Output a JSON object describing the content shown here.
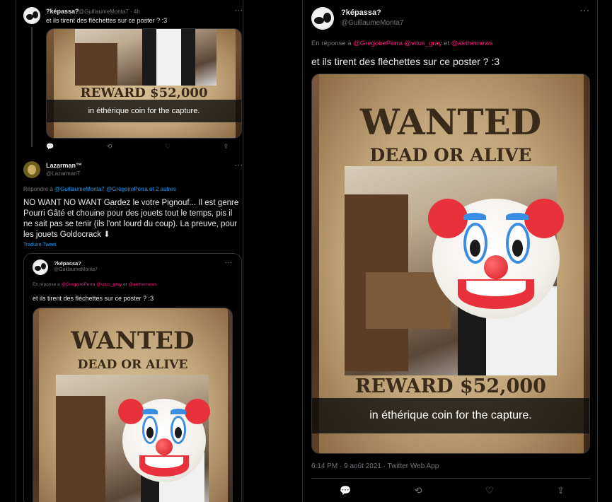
{
  "left": {
    "tweet1": {
      "name": "?képassa?",
      "handle": "@GuillaumeMonta7 · 4h",
      "more": "···",
      "text": "et ils tirent des fléchettes sur ce poster ? :3",
      "media": {
        "reward": "REWARD $52,000",
        "caption": "in éthérique coin for the capture."
      },
      "actions": {
        "reply": "💬",
        "retweet": "⟲",
        "like": "♡",
        "share": "⇪"
      }
    },
    "tweet2": {
      "name": "Lazarman™",
      "handle": "@LazarmanT",
      "more": "···",
      "reply_prefix": "Répondre à ",
      "reply_mentions": "@GuillaumeMonta7 @GrégoirePerra et 2 autres",
      "text": "NO WANT NO WANT Gardez le votre Pignouf... Il est genre Pourri Gâté et chouine pour des jouets tout le temps, pis il ne sait pas se tenir (ils l'ont lourd du coup). La preuve, pour les jouets Goldocrack ⬇",
      "translate": "Traduire Tweet"
    },
    "quoted": {
      "name": "?képassa?",
      "handle": "@GuillaumeMonta7",
      "more": "···",
      "reply_prefix": "En réponse à ",
      "reply_mentions": "@GregoirePerra @vitus_gray",
      "reply_and": " et ",
      "reply_last": "@aethernews",
      "text": "et ils tirent des fléchettes sur ce poster ? :3",
      "media": {
        "wanted": "WANTED",
        "dead": "DEAD OR ALIVE"
      }
    }
  },
  "right": {
    "name": "?képassa?",
    "handle": "@GuillaumeMonta7",
    "more": "···",
    "reply_prefix": "En réponse à ",
    "reply_mentions": "@GregoirePerra @vitus_gray",
    "reply_and": " et ",
    "reply_last": "@aethernews",
    "text": "et ils tirent des fléchettes sur ce poster ? :3",
    "media": {
      "wanted": "WANTED",
      "dead": "DEAD OR ALIVE",
      "reward": "REWARD $52,000",
      "caption": "in éthérique coin for the capture."
    },
    "meta": "6:14 PM · 9 août 2021 · Twitter Web App",
    "actions": {
      "reply": "💬",
      "retweet": "⟲",
      "like": "♡",
      "share": "⇪"
    }
  },
  "colors": {
    "background": "#000000",
    "mention": "#f91880",
    "link": "#1d9bf0",
    "muted": "#71767b"
  }
}
